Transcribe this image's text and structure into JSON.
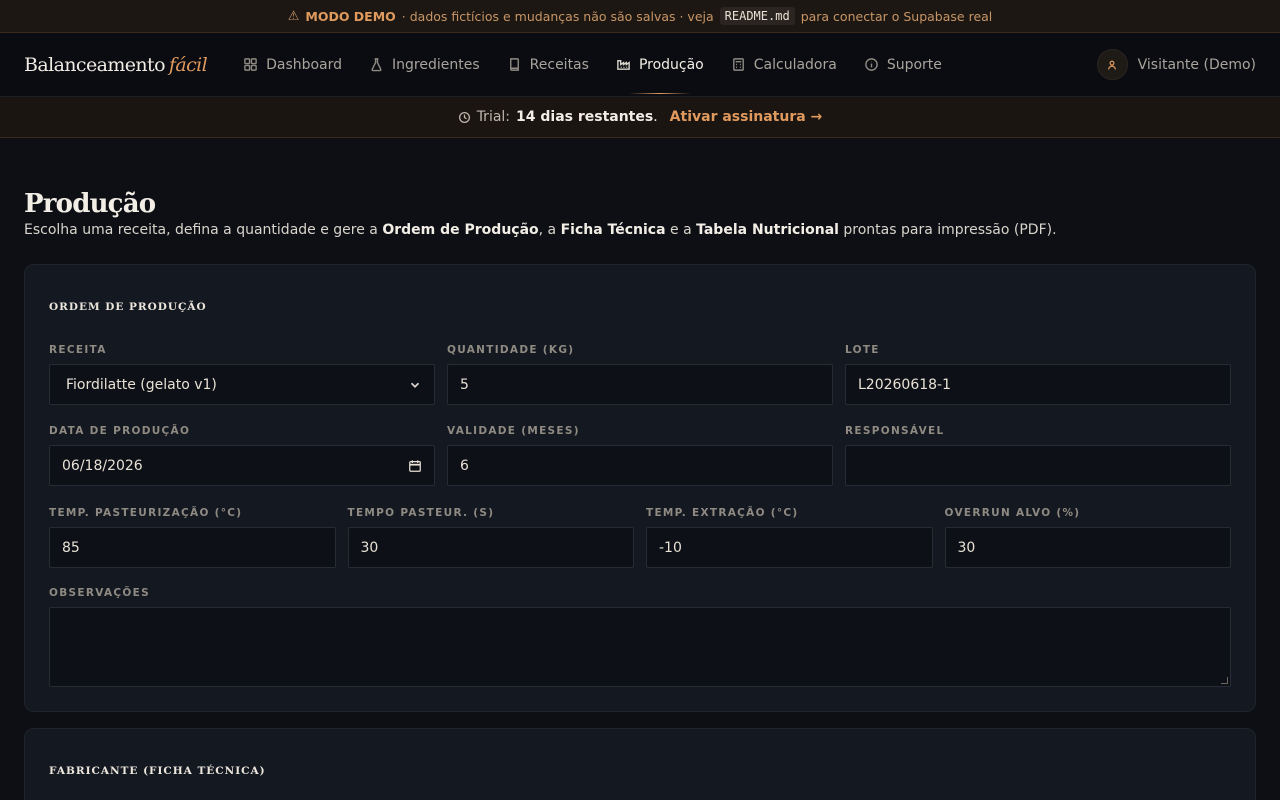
{
  "demo_bar": {
    "badge": "MODO DEMO",
    "text1": "· dados fictícios e mudanças não são salvas · veja",
    "code": "README.md",
    "text2": "para conectar o Supabase real"
  },
  "brand": {
    "name": "Balanceamento",
    "accent": "fácil"
  },
  "nav": {
    "items": [
      {
        "label": "Dashboard",
        "icon": "grid-icon"
      },
      {
        "label": "Ingredientes",
        "icon": "flask-icon"
      },
      {
        "label": "Receitas",
        "icon": "book-icon"
      },
      {
        "label": "Produção",
        "icon": "factory-icon"
      },
      {
        "label": "Calculadora",
        "icon": "calculator-icon"
      },
      {
        "label": "Suporte",
        "icon": "info-icon"
      }
    ],
    "active": "Produção"
  },
  "user": {
    "name": "Visitante (Demo)"
  },
  "trial": {
    "prefix": "Trial:",
    "days": "14 dias restantes",
    "dot": ".",
    "cta": "Ativar assinatura →"
  },
  "page": {
    "title": "Produção",
    "subtitle": {
      "p1": "Escolha uma receita, defina a quantidade e gere a",
      "b1": "Ordem de Produção",
      "p2": ", a",
      "b2": "Ficha Técnica",
      "p3": "e a",
      "b3": "Tabela Nutricional",
      "p4": "prontas para impressão (PDF)."
    }
  },
  "order_card": {
    "title": "Ordem de produção",
    "fields": {
      "receita": {
        "label": "Receita",
        "value": "Fiordilatte (gelato v1)"
      },
      "quantidade": {
        "label": "Quantidade (kg)",
        "value": "5"
      },
      "lote": {
        "label": "Lote",
        "value": "L20260618-1"
      },
      "data": {
        "label": "Data de produção",
        "value": "06/18/2026"
      },
      "validade": {
        "label": "Validade (meses)",
        "value": "6"
      },
      "responsavel": {
        "label": "Responsável",
        "value": ""
      },
      "temp_past": {
        "label": "Temp. pasteurização (°C)",
        "value": "85"
      },
      "tempo_past": {
        "label": "Tempo pasteur. (s)",
        "value": "30"
      },
      "temp_ext": {
        "label": "Temp. extração (°C)",
        "value": "-10"
      },
      "overrun": {
        "label": "Overrun alvo (%)",
        "value": "30"
      },
      "observacoes": {
        "label": "Observações",
        "value": ""
      }
    }
  },
  "fabricante_card": {
    "title": "Fabricante (ficha técnica)"
  },
  "colors": {
    "accent": "#e09a5e",
    "background": "#0d0f15",
    "card": "#141821"
  }
}
